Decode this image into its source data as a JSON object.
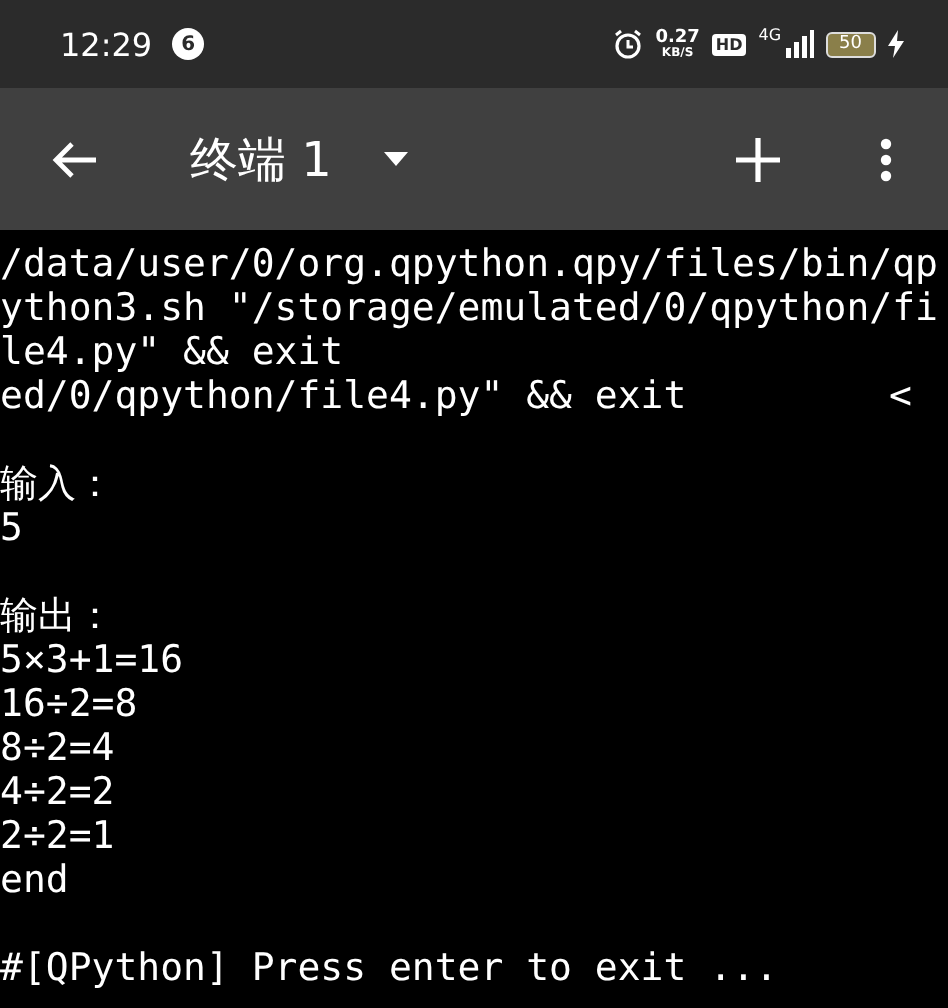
{
  "status_bar": {
    "time": "12:29",
    "notification_count": "6",
    "net_speed": "0.27",
    "net_speed_unit": "KB/S",
    "hd": "HD",
    "network": "4G",
    "battery": "50"
  },
  "toolbar": {
    "title": "终端 1"
  },
  "terminal": {
    "blocks": [
      {
        "lines": [
          {
            "text": "/data/user/0/org.qpython.qpy/files/bin/qp"
          },
          {
            "text": "ython3.sh \"/storage/emulated/0/qpython/fi"
          },
          {
            "text": "le4.py\" && exit"
          },
          {
            "text": "ed/0/qpython/file4.py\" && exit",
            "right": "<"
          }
        ]
      },
      {
        "lines": [
          {
            "text": "输入："
          },
          {
            "text": "5"
          }
        ]
      },
      {
        "lines": [
          {
            "text": "输出："
          },
          {
            "text": "5×3+1=16"
          },
          {
            "text": "16÷2=8"
          },
          {
            "text": "8÷2=4"
          },
          {
            "text": "4÷2=2"
          },
          {
            "text": "2÷2=1"
          },
          {
            "text": "end"
          }
        ]
      },
      {
        "lines": [
          {
            "text": "#[QPython] Press enter to exit ..."
          }
        ]
      }
    ]
  }
}
